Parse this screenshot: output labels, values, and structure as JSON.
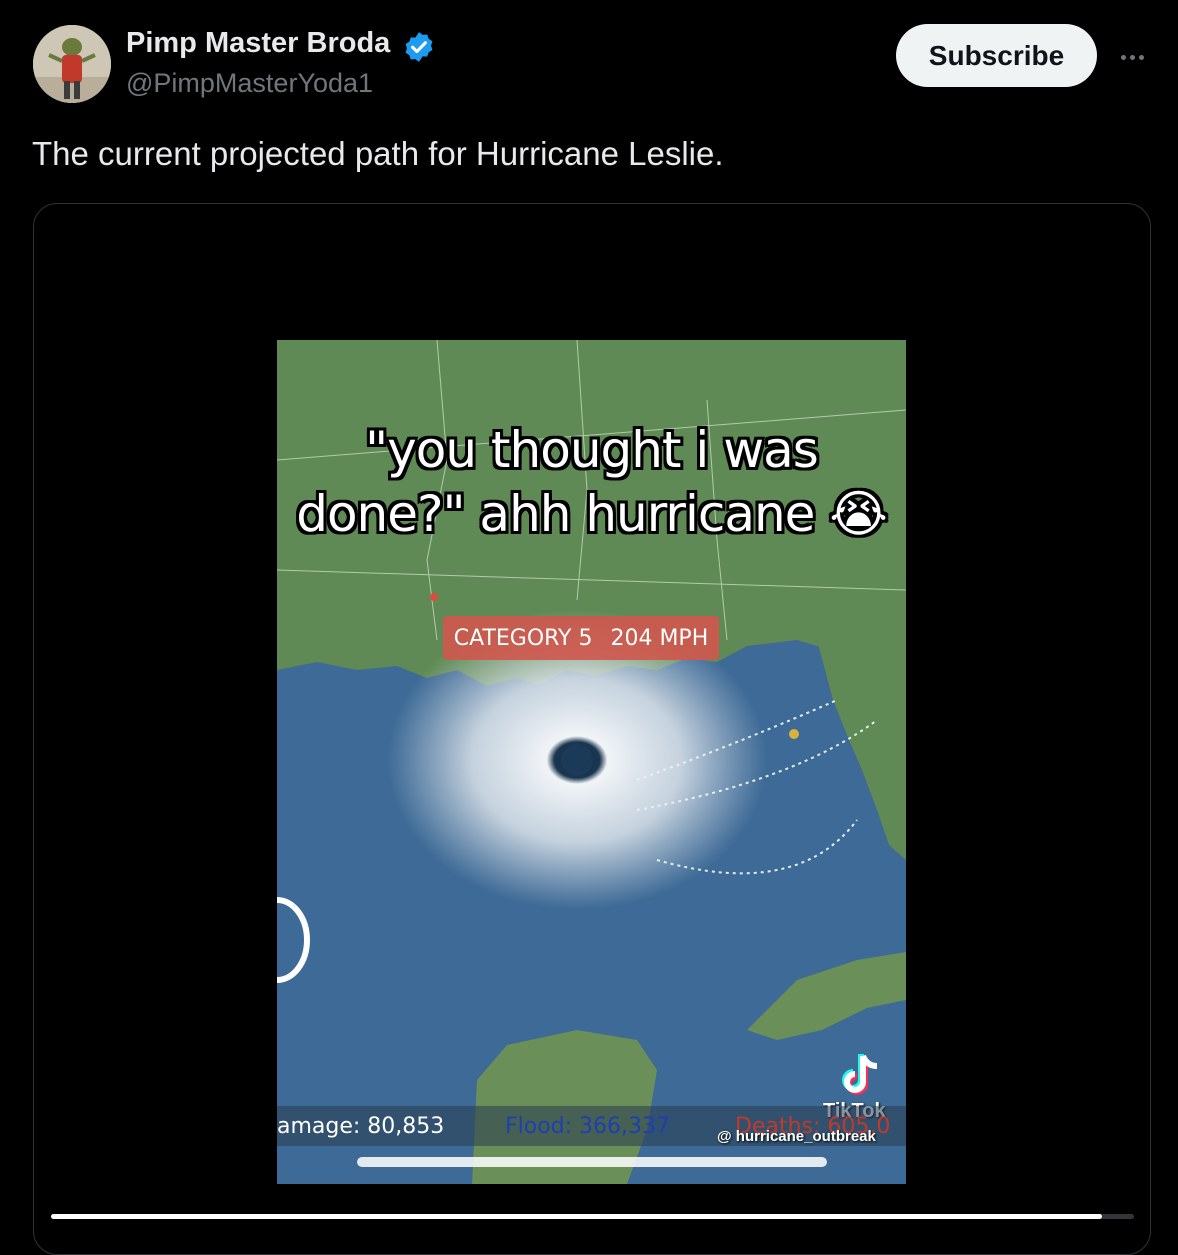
{
  "author": {
    "display_name": "Pimp Master Broda",
    "handle": "@PimpMasterYoda1",
    "verified": true
  },
  "header": {
    "subscribe_label": "Subscribe"
  },
  "tweet": {
    "text": "The current projected path for Hurricane Leslie."
  },
  "video": {
    "caption_line1": "\"you thought i was",
    "caption_line2": "done?\" ahh hurricane",
    "caption_emoji": "😭",
    "category": "CATEGORY 5",
    "speed": "204 MPH",
    "stat_damage": "amage: 80,853",
    "stat_flood": "Flood: 366,337",
    "stat_deaths": "Deaths: 605,0",
    "tiktok_label": "TikTok",
    "tiktok_user": "@ hurricane_outbreak",
    "progress_fraction": 0.97
  },
  "colors": {
    "background": "#000000",
    "text_primary": "#e7e9ea",
    "text_secondary": "#71767b",
    "verified_blue": "#1d9bf0",
    "subscribe_bg": "#eff3f4"
  }
}
